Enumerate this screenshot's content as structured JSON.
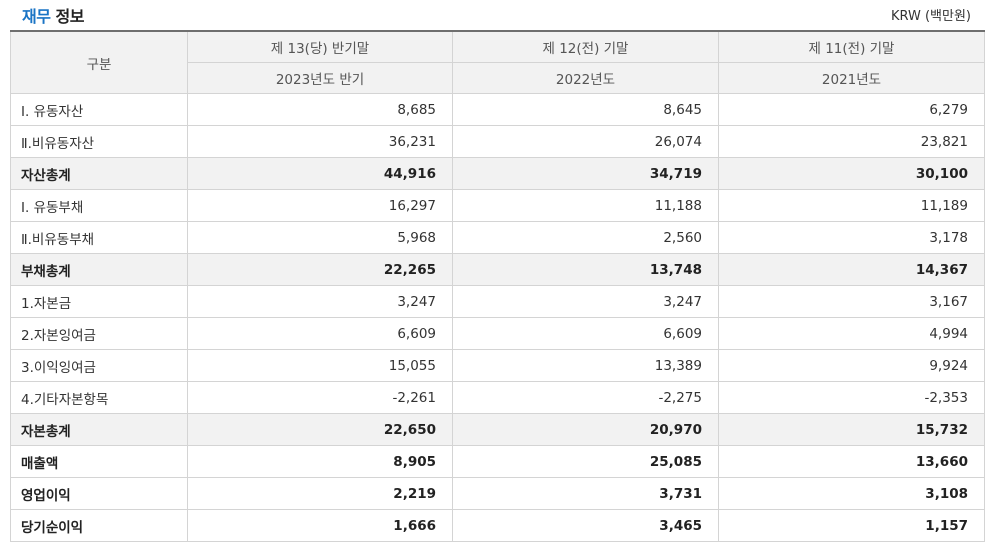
{
  "header": {
    "title_accent": "재무",
    "title_rest": " 정보",
    "unit": "KRW (백만원)"
  },
  "table": {
    "corner_label": "구분",
    "columns": [
      {
        "period": "제 13(당) 반기말",
        "year": "2023년도 반기"
      },
      {
        "period": "제 12(전) 기말",
        "year": "2022년도"
      },
      {
        "period": "제 11(전) 기말",
        "year": "2021년도"
      }
    ],
    "rows": [
      {
        "label": "Ⅰ. 유동자산",
        "values": [
          "8,685",
          "8,645",
          "6,279"
        ],
        "style": "normal"
      },
      {
        "label": "Ⅱ.비유동자산",
        "values": [
          "36,231",
          "26,074",
          "23,821"
        ],
        "style": "normal"
      },
      {
        "label": "자산총계",
        "values": [
          "44,916",
          "34,719",
          "30,100"
        ],
        "style": "total"
      },
      {
        "label": "Ⅰ. 유동부채",
        "values": [
          "16,297",
          "11,188",
          "11,189"
        ],
        "style": "normal"
      },
      {
        "label": "Ⅱ.비유동부채",
        "values": [
          "5,968",
          "2,560",
          "3,178"
        ],
        "style": "normal"
      },
      {
        "label": "부채총계",
        "values": [
          "22,265",
          "13,748",
          "14,367"
        ],
        "style": "total"
      },
      {
        "label": "1.자본금",
        "values": [
          "3,247",
          "3,247",
          "3,167"
        ],
        "style": "normal"
      },
      {
        "label": "2.자본잉여금",
        "values": [
          "6,609",
          "6,609",
          "4,994"
        ],
        "style": "normal"
      },
      {
        "label": "3.이익잉여금",
        "values": [
          "15,055",
          "13,389",
          "9,924"
        ],
        "style": "normal"
      },
      {
        "label": "4.기타자본항목",
        "values": [
          "-2,261",
          "-2,275",
          "-2,353"
        ],
        "style": "normal"
      },
      {
        "label": "자본총계",
        "values": [
          "22,650",
          "20,970",
          "15,732"
        ],
        "style": "total"
      },
      {
        "label": "매출액",
        "values": [
          "8,905",
          "25,085",
          "13,660"
        ],
        "style": "bold"
      },
      {
        "label": "영업이익",
        "values": [
          "2,219",
          "3,731",
          "3,108"
        ],
        "style": "bold"
      },
      {
        "label": "당기순이익",
        "values": [
          "1,666",
          "3,465",
          "1,157"
        ],
        "style": "bold"
      }
    ]
  }
}
